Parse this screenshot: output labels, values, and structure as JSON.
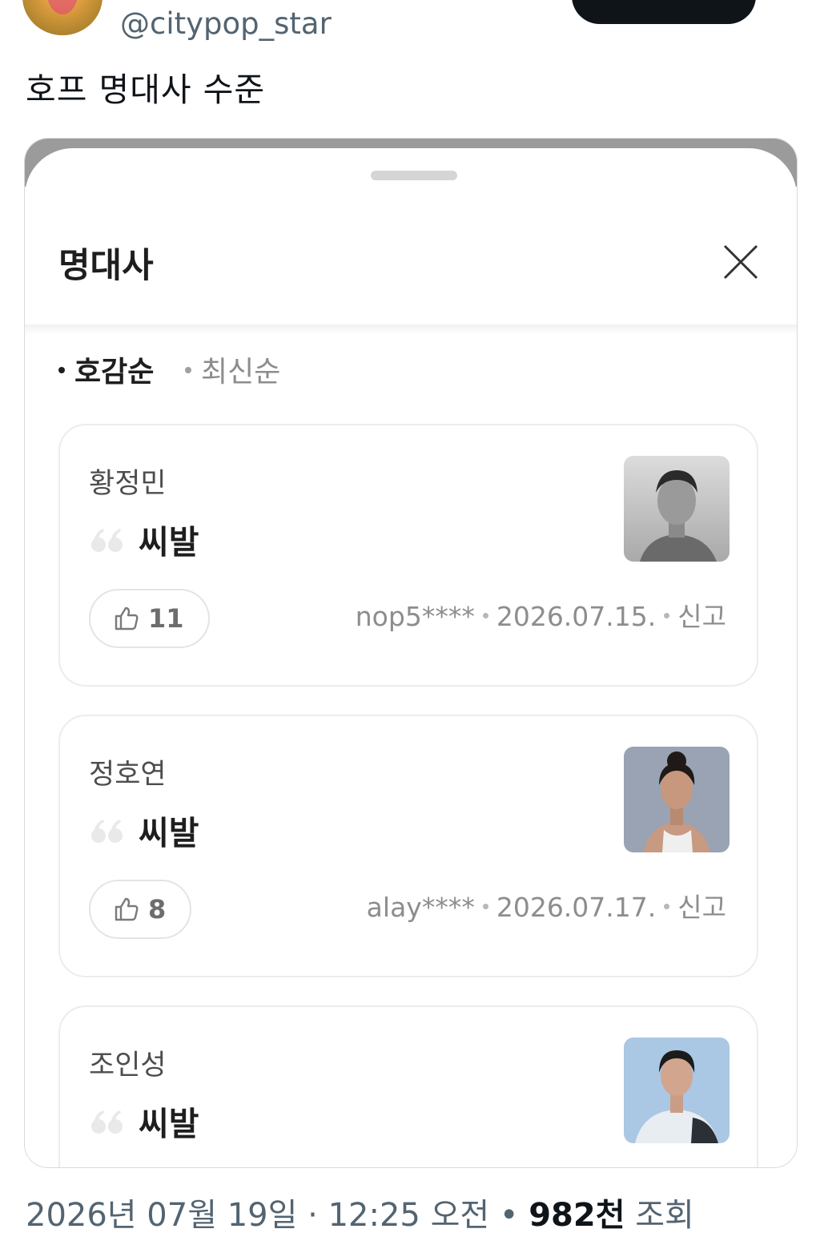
{
  "tweet": {
    "handle": "@citypop_star",
    "text": "호프 명대사 수준",
    "footer": {
      "date": "2026년 07월 19일",
      "sep1": " · ",
      "time": "12:25 오전",
      "sep2": " • ",
      "views_count": "982천",
      "views_label": " 조회"
    }
  },
  "sheet": {
    "title": "명대사",
    "sort_options": [
      {
        "label": "호감순",
        "selected": true
      },
      {
        "label": "최신순",
        "selected": false
      }
    ],
    "cards": [
      {
        "name": "황정민",
        "quote": "씨발",
        "likes": "11",
        "user": "nop5****",
        "date": "2026.07.15.",
        "report": "신고"
      },
      {
        "name": "정호연",
        "quote": "씨발",
        "likes": "8",
        "user": "alay****",
        "date": "2026.07.17.",
        "report": "신고"
      },
      {
        "name": "조인성",
        "quote": "씨발"
      }
    ]
  },
  "colors": {
    "text_primary": "#0f1419",
    "text_secondary": "#536471",
    "card_border": "#ececec",
    "muted": "#8d8d8d"
  },
  "icons": [
    "more-icon",
    "close-icon",
    "quote-icon",
    "thumbs-up-icon"
  ]
}
